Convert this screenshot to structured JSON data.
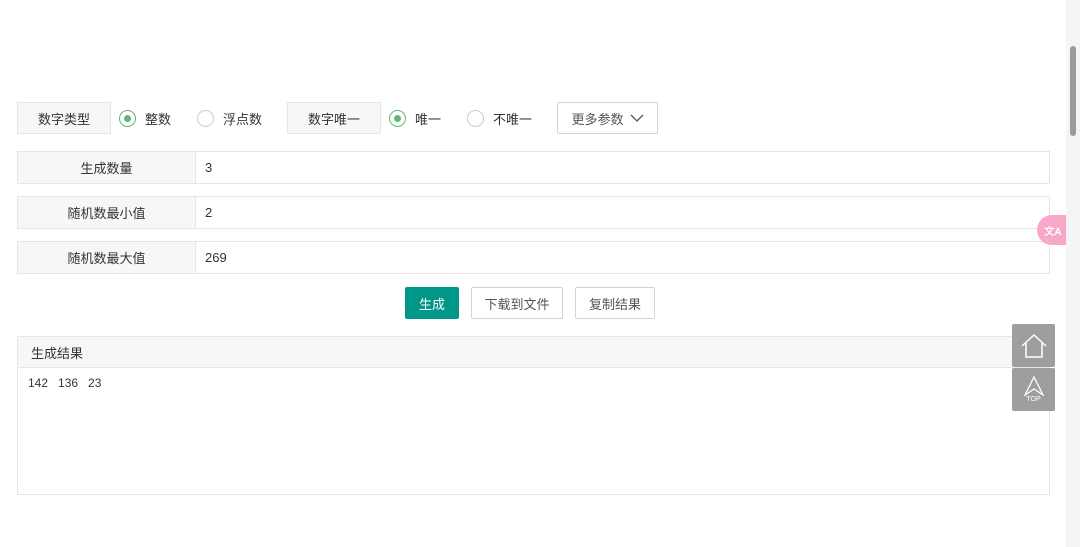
{
  "options": {
    "number_type_label": "数字类型",
    "integer": "整数",
    "float": "浮点数",
    "unique_label": "数字唯一",
    "unique": "唯一",
    "not_unique": "不唯一",
    "more_params": "更多参数"
  },
  "fields": [
    {
      "label": "生成数量",
      "value": "3"
    },
    {
      "label": "随机数最小值",
      "value": "2"
    },
    {
      "label": "随机数最大值",
      "value": "269"
    }
  ],
  "actions": {
    "generate": "生成",
    "download": "下载到文件",
    "copy": "复制结果"
  },
  "result": {
    "title": "生成结果",
    "value": "142   136   23"
  },
  "side": {
    "top_label": "TOP",
    "translate": "文A"
  },
  "colors": {
    "accent": "#009688",
    "radio": "#5fb878"
  }
}
